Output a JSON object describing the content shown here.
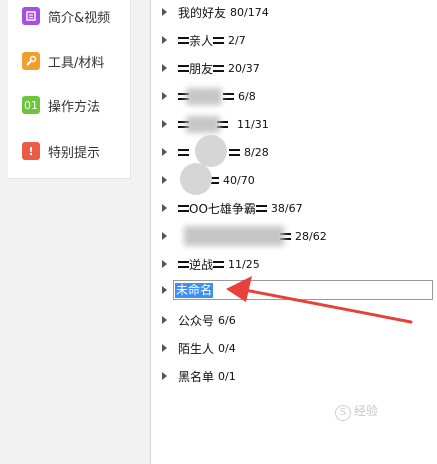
{
  "sidebar": {
    "items": [
      {
        "icon": "intro-video-icon",
        "icon_color": "#a352e0",
        "label": "简介&视频"
      },
      {
        "icon": "wrench-icon",
        "icon_color": "#f0a02a",
        "label": "工具/材料"
      },
      {
        "icon": "steps-icon",
        "icon_color": "#6cc53b",
        "icon_text": "01",
        "label": "操作方法"
      },
      {
        "icon": "warning-icon",
        "icon_color": "#ec5b45",
        "icon_text": "!",
        "label": "特别提示"
      }
    ]
  },
  "groups": [
    {
      "name": "我的好友",
      "count": "80/174"
    },
    {
      "name": "亲人",
      "count": "2/7"
    },
    {
      "name": "朋友",
      "count": "20/37"
    },
    {
      "name": "",
      "count": "6/8"
    },
    {
      "name": "",
      "count": "11/31"
    },
    {
      "name": "",
      "count": "8/28"
    },
    {
      "name": "",
      "count": "40/70"
    },
    {
      "name": "OO七雄争霸",
      "count": "38/67"
    },
    {
      "name": "",
      "count": "28/62"
    },
    {
      "name": "逆战",
      "count": "11/25"
    },
    {
      "name": "公众号",
      "count": "6/6"
    },
    {
      "name": "陌生人",
      "count": "0/4"
    },
    {
      "name": "黑名单",
      "count": "0/1"
    }
  ],
  "rename": {
    "value": "未命名"
  },
  "colors": {
    "selection": "#3e8ff0",
    "arrow": "#e8403a"
  },
  "watermark": {
    "symbol": "S",
    "text": "经验"
  }
}
